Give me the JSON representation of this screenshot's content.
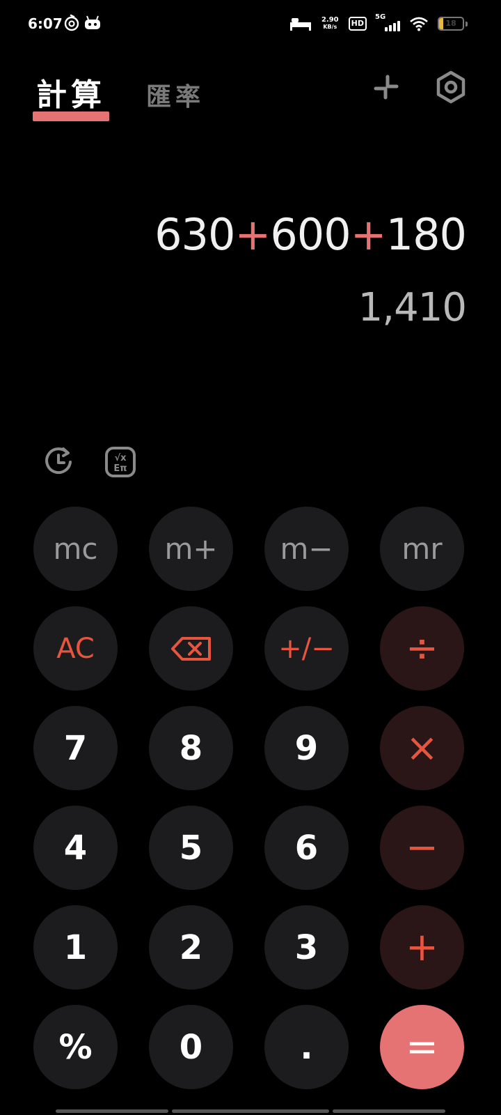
{
  "status_bar": {
    "time": "6:07",
    "net_speed_value": "2.90",
    "net_speed_unit": "KB/s",
    "hd_label": "HD",
    "network_gen": "5G",
    "battery_level": "18",
    "battery_fraction": 0.18
  },
  "tabs": [
    {
      "label": "計算",
      "active": true
    },
    {
      "label": "匯率",
      "active": false
    }
  ],
  "header_icons": [
    "collapse-icon",
    "settings-icon"
  ],
  "display": {
    "expression_parts": [
      "630",
      "+",
      "600",
      "+",
      "180"
    ],
    "result": "1,410"
  },
  "tools": [
    "history-icon",
    "scientific-icon"
  ],
  "keys": {
    "mc": "mc",
    "mplus": "m+",
    "mminus": "m−",
    "mr": "mr",
    "ac": "AC",
    "backspace": "backspace-icon",
    "sign": "+/−",
    "divide": "÷",
    "k7": "7",
    "k8": "8",
    "k9": "9",
    "multiply": "×",
    "k4": "4",
    "k5": "5",
    "k6": "6",
    "minus": "−",
    "k1": "1",
    "k2": "2",
    "k3": "3",
    "plus": "+",
    "percent": "%",
    "k0": "0",
    "dot": ".",
    "equals": "="
  },
  "colors": {
    "accent": "#e57373",
    "operator_text": "#e8553f",
    "key_bg": "#1c1c1e",
    "operator_bg": "#2a1616",
    "background": "#000000"
  }
}
